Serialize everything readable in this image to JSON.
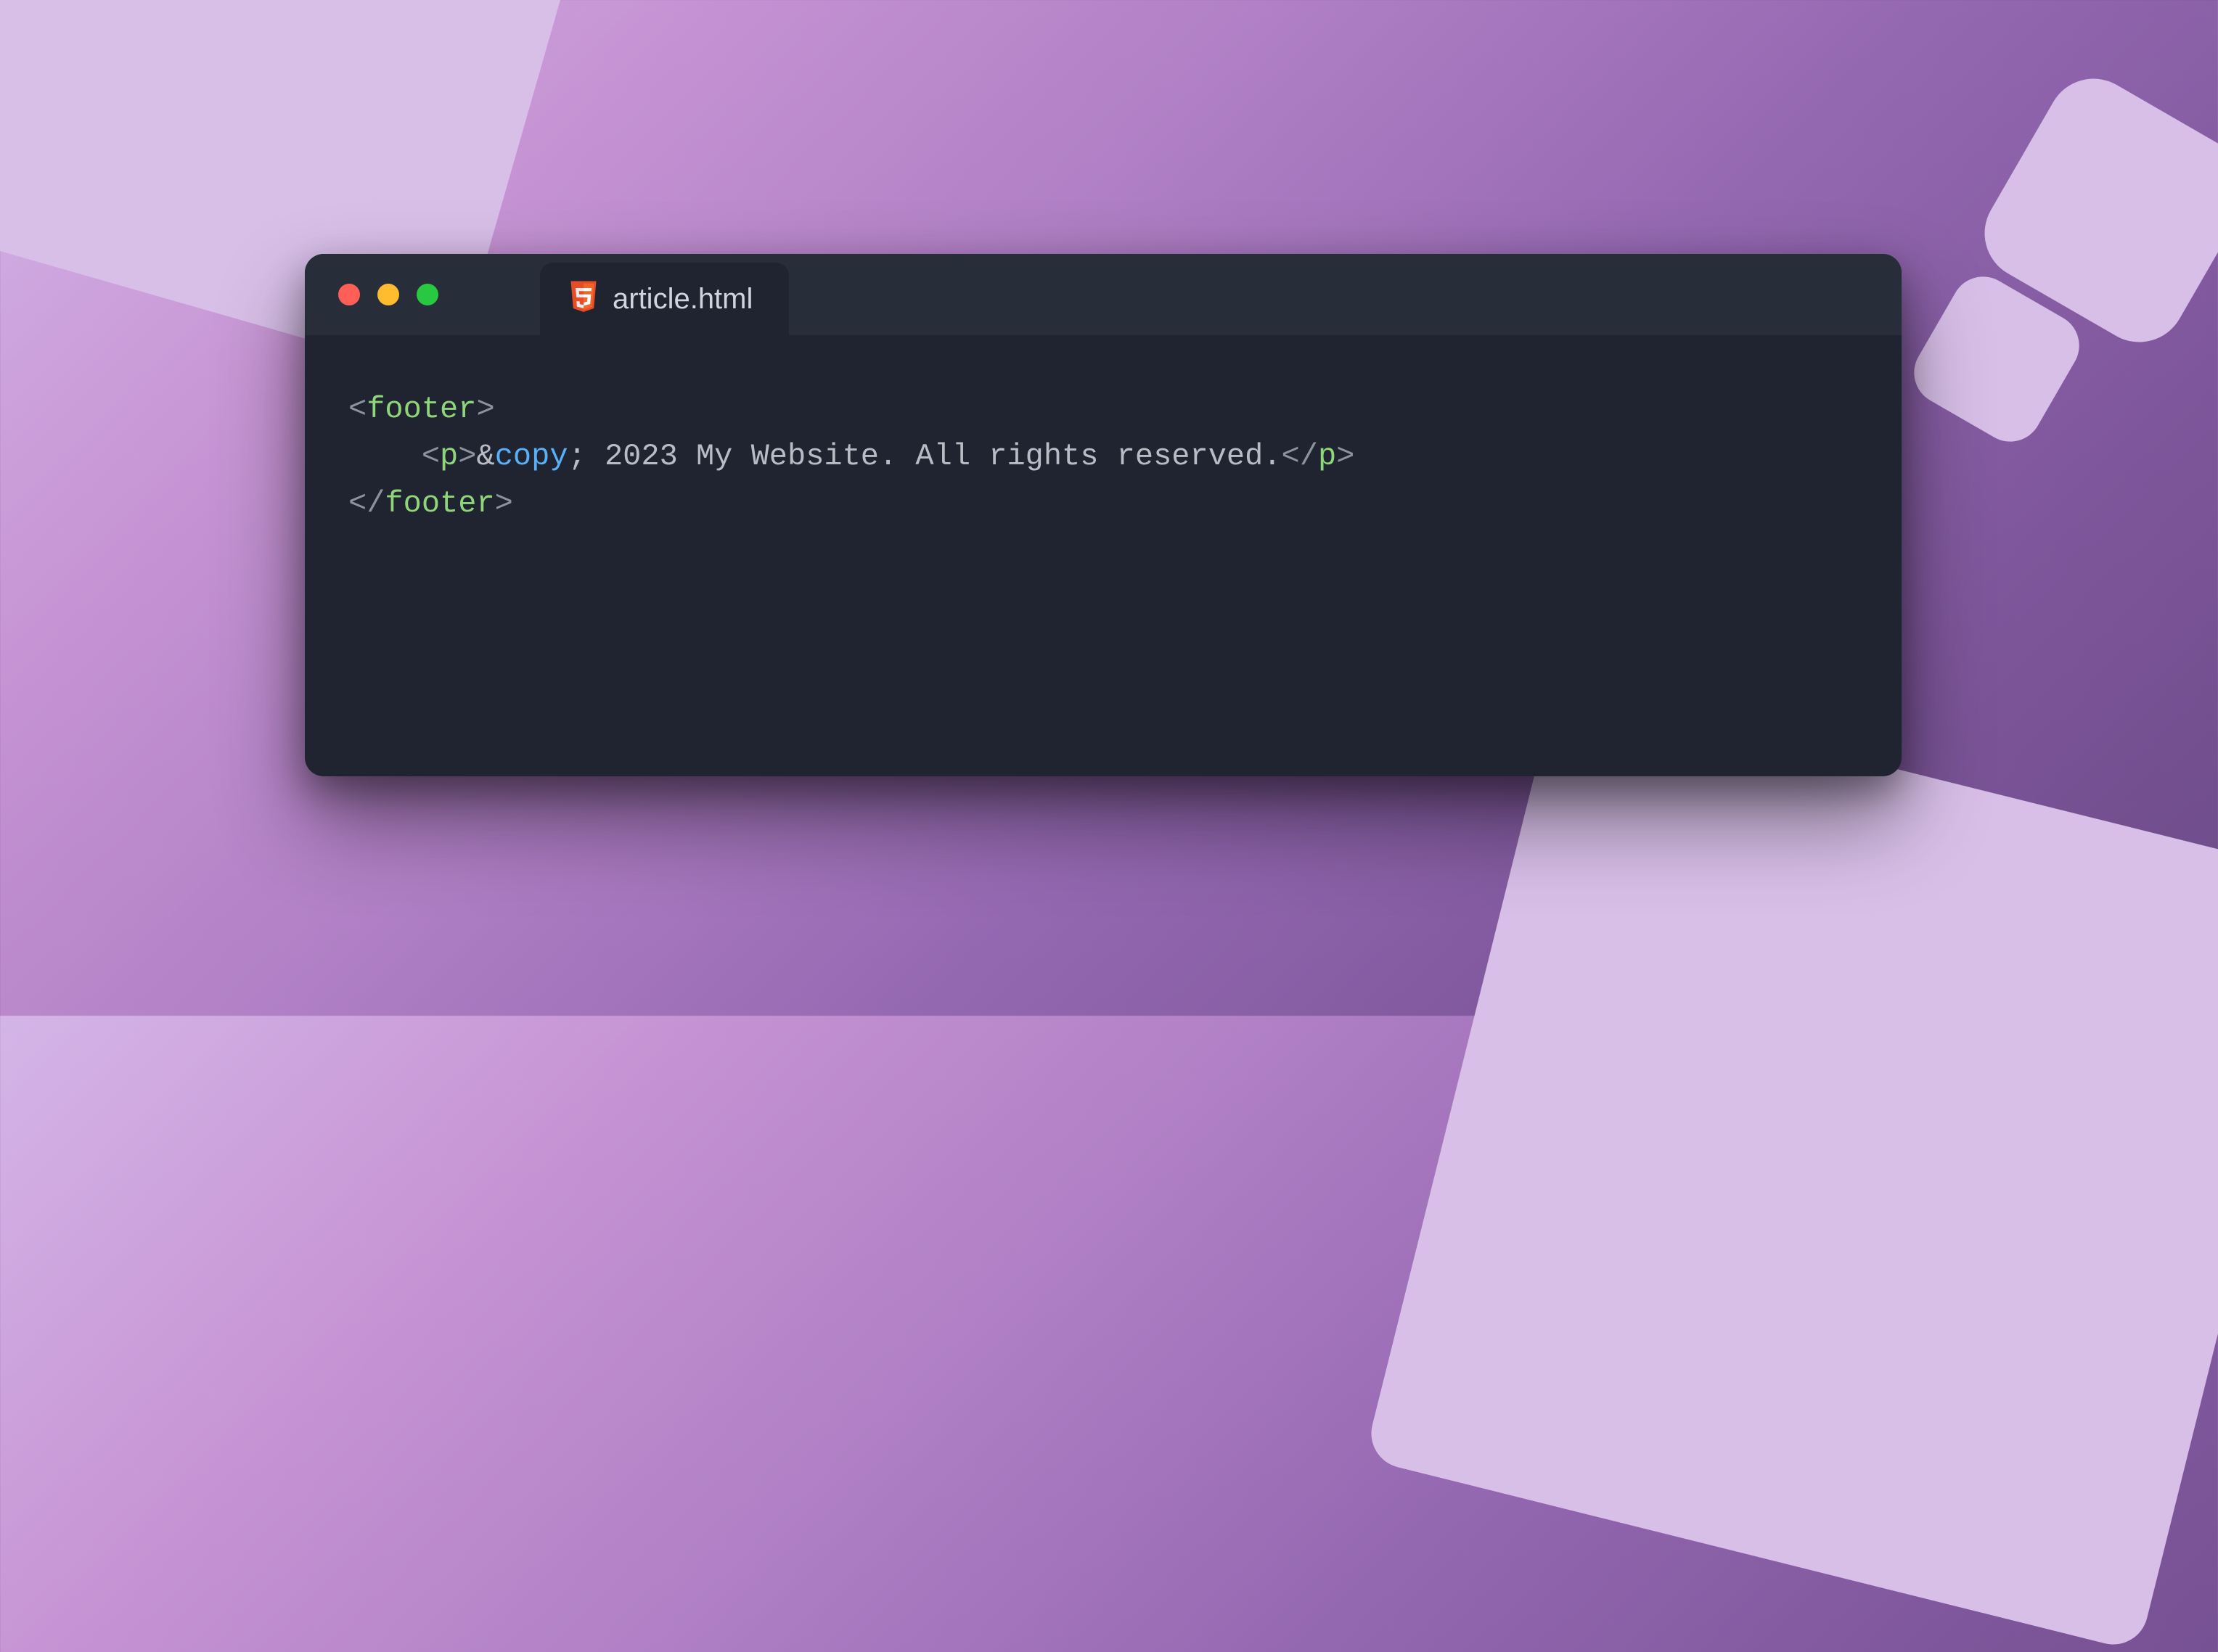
{
  "tab": {
    "filename": "article.html",
    "icon": "html5-icon"
  },
  "window_controls": {
    "close": "close",
    "minimize": "minimize",
    "zoom": "zoom"
  },
  "code": {
    "line1": {
      "open_br": "<",
      "tag": "footer",
      "close_br": ">"
    },
    "line2": {
      "indent": "    ",
      "p_open_br": "<",
      "p_tag": "p",
      "p_close_br": ">",
      "amp": "&",
      "entity": "copy",
      "semi": ";",
      "text": " 2023 My Website. All rights reserved.",
      "p_end_open": "</",
      "p_end_tag": "p",
      "p_end_close": ">"
    },
    "line3": {
      "open_br": "</",
      "tag": "footer",
      "close_br": ">"
    }
  }
}
